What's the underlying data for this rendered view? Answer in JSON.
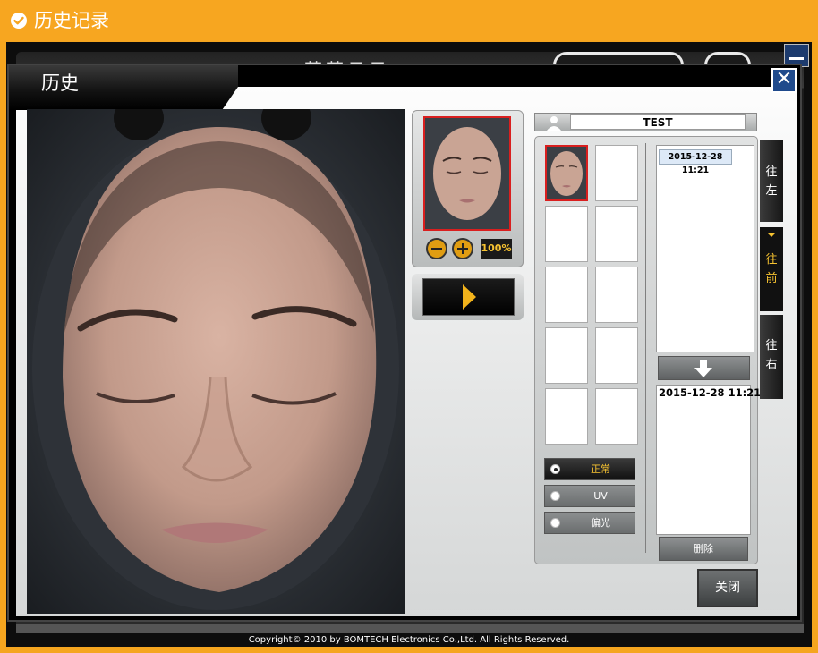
{
  "header": {
    "title": "历史记录",
    "icon": "check-circle-icon"
  },
  "background_app": {
    "title": "莱莱日云",
    "copyright": "Copyright© 2010 by BOMTECH Electronics Co.,Ltd. All Rights Reserved."
  },
  "dialog": {
    "title": "历史",
    "close_x": "✕",
    "zoom_level": "100%",
    "user_name": "TEST",
    "history_dates": [
      "2015-12-28 11:21"
    ],
    "selected_dates": [
      "2015-12-28 11:21"
    ],
    "modes": [
      {
        "label": "正常",
        "active": true
      },
      {
        "label": "UV",
        "active": false
      },
      {
        "label": "偏光",
        "active": false
      }
    ],
    "delete_label": "删除",
    "close_label": "关闭",
    "side_tabs": [
      {
        "label": "往左",
        "active": false
      },
      {
        "label": "往前",
        "active": true
      },
      {
        "label": "往右",
        "active": false
      }
    ]
  },
  "colors": {
    "accent": "#f7a620",
    "highlight": "#f7c331",
    "selection_border": "#d91f1f"
  }
}
